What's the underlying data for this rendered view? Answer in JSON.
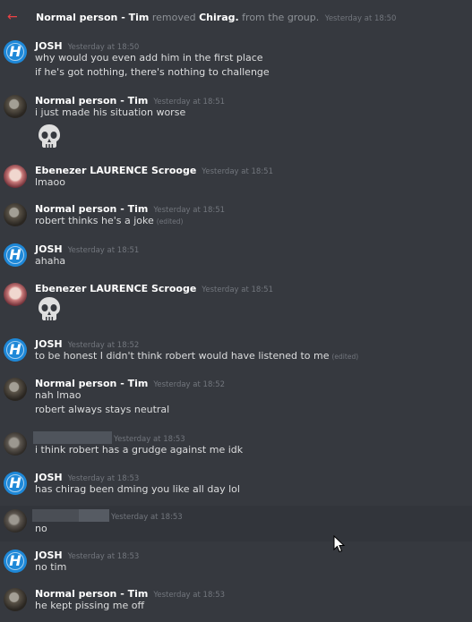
{
  "system_message": {
    "actor": "Normal person - Tim",
    "action": "removed",
    "target": "Chirag.",
    "suffix": "from the group.",
    "timestamp": "Yesterday at 18:50"
  },
  "messages": [
    {
      "author": "JOSH",
      "timestamp": "Yesterday at 18:50",
      "lines": [
        "why would you even add him in the first place",
        "if he's got nothing, there's nothing to challenge"
      ]
    },
    {
      "author": "Normal person - Tim",
      "timestamp": "Yesterday at 18:51",
      "lines": [
        "i just made his situation worse"
      ],
      "emoji": "skull"
    },
    {
      "author": "Ebenezer LAURENCE Scrooge",
      "timestamp": "Yesterday at 18:51",
      "lines": [
        "lmaoo"
      ]
    },
    {
      "author": "Normal person - Tim",
      "timestamp": "Yesterday at 18:51",
      "lines": [
        "robert thinks he's a joke"
      ],
      "edited": "(edited)"
    },
    {
      "author": "JOSH",
      "timestamp": "Yesterday at 18:51",
      "lines": [
        "ahaha"
      ]
    },
    {
      "author": "Ebenezer LAURENCE Scrooge",
      "timestamp": "Yesterday at 18:51",
      "lines": [],
      "emoji": "skull"
    },
    {
      "author": "JOSH",
      "timestamp": "Yesterday at 18:52",
      "lines": [
        "to be honest I didn't think robert would have listened to me"
      ],
      "edited": "(edited)"
    },
    {
      "author": "Normal person - Tim",
      "timestamp": "Yesterday at 18:52",
      "lines": [
        "nah lmao",
        "robert always stays neutral"
      ]
    },
    {
      "author": "",
      "timestamp": "Yesterday at 18:53",
      "lines": [
        "i think robert has a grudge against me idk"
      ]
    },
    {
      "author": "JOSH",
      "timestamp": "Yesterday at 18:53",
      "lines": [
        "has chirag been dming you like all day lol"
      ]
    },
    {
      "author": "",
      "timestamp": "Yesterday at 18:53",
      "lines": [
        "no"
      ]
    },
    {
      "author": "JOSH",
      "timestamp": "Yesterday at 18:53",
      "lines": [
        "no tim"
      ]
    },
    {
      "author": "Normal person - Tim",
      "timestamp": "Yesterday at 18:53",
      "lines": [
        "he kept pissing me off"
      ]
    }
  ],
  "colors": {
    "background": "#36393f",
    "system_arrow": "#ed4245",
    "author": "#ffffff",
    "timestamp": "#72767d"
  }
}
